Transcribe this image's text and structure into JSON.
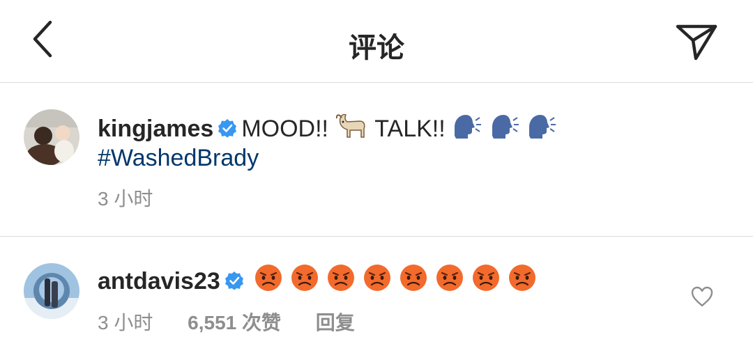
{
  "header": {
    "title": "评论",
    "back_icon": "chevron-left-icon",
    "share_icon": "paper-plane-icon"
  },
  "caption": {
    "username": "kingjames",
    "verified": true,
    "text_part1": "MOOD!!",
    "text_part2": "TALK!!",
    "hashtag": "#WashedBrady",
    "time": "3 小时",
    "emojis": [
      "goat",
      "speaking-head",
      "speaking-head",
      "speaking-head"
    ]
  },
  "reply": {
    "username": "antdavis23",
    "verified": true,
    "emoji_count": 8,
    "emoji": "angry-face",
    "time": "3 小时",
    "likes": "6,551 次赞",
    "reply_label": "回复"
  },
  "colors": {
    "verified": "#3897f0",
    "hashtag": "#00376b",
    "meta": "#8e8e8e",
    "divider": "#dbdbdb"
  }
}
